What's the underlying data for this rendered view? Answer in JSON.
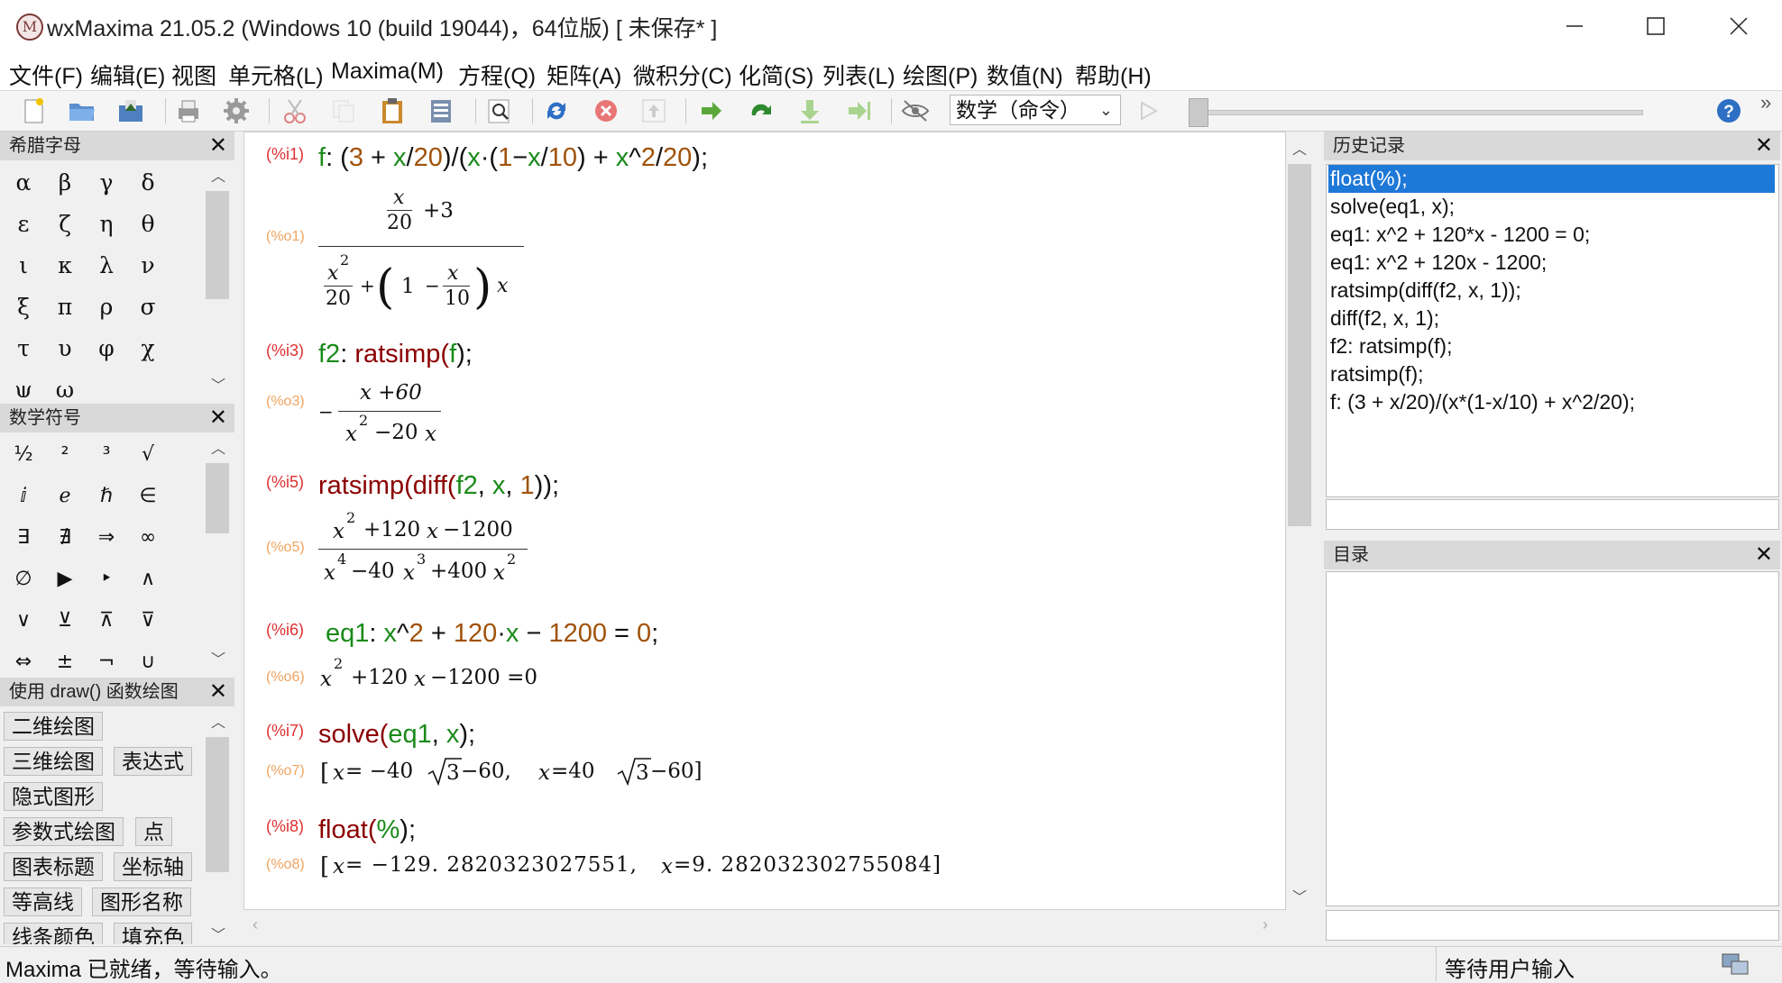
{
  "window": {
    "title": "wxMaxima 21.05.2 (Windows 10 (build 19044)，64位版) [ 未保存* ]",
    "icon": "maxima-logo-icon",
    "app_icon_glyph": "M"
  },
  "menu": [
    "文件(F)",
    "编辑(E)",
    "视图",
    "单元格(L)",
    "Maxima(M)",
    "方程(Q)",
    "矩阵(A)",
    "微积分(C)",
    "化简(S)",
    "列表(L)",
    "绘图(P)",
    "数值(N)",
    "帮助(H)"
  ],
  "toolbar": {
    "mode_select": "数学（命令）",
    "icons": [
      "new-file-icon",
      "open-folder-icon",
      "save-icon",
      "print-icon",
      "settings-icon",
      "cut-icon",
      "copy-icon",
      "paste-icon",
      "paste-special-icon",
      "find-icon",
      "refresh-icon",
      "interrupt-icon",
      "upload-icon",
      "evaluate-icon",
      "step-icon",
      "down-icon",
      "skip-icon",
      "hide-icon",
      "play-icon",
      "help-icon"
    ]
  },
  "greek_panel": {
    "title": "希腊字母",
    "letters": [
      "α",
      "β",
      "γ",
      "δ",
      "ε",
      "ζ",
      "η",
      "θ",
      "ι",
      "κ",
      "λ",
      "ν",
      "ξ",
      "π",
      "ρ",
      "σ",
      "τ",
      "υ",
      "φ",
      "χ",
      "ψ",
      "ω"
    ]
  },
  "math_panel": {
    "title": "数学符号",
    "symbols": [
      "½",
      "²",
      "³",
      "√",
      "ⅈ",
      "ℯ",
      "ℏ",
      "∈",
      "∃",
      "∄",
      "⇒",
      "∞",
      "∅",
      "▶",
      "‣",
      "∧",
      "∨",
      "⊻",
      "⊼",
      "⊽",
      "⇔",
      "±",
      "¬",
      "∪"
    ]
  },
  "draw_panel": {
    "title": "使用 draw() 函数绘图",
    "buttons": [
      [
        "二维绘图"
      ],
      [
        "三维绘图",
        "表达式"
      ],
      [
        "隐式图形"
      ],
      [
        "参数式绘图",
        "点"
      ],
      [
        "图表标题",
        "坐标轴"
      ],
      [
        "等高线",
        "图形名称"
      ],
      [
        "线条颜色",
        "填充色"
      ]
    ]
  },
  "worksheet": {
    "cells": [
      {
        "in_label": "(%i1)",
        "out_label": "(%o1)"
      },
      {
        "in_label": "(%i3)",
        "out_label": "(%o3)"
      },
      {
        "in_label": "(%i5)",
        "out_label": "(%o5)"
      },
      {
        "in_label": "(%i6)",
        "out_label": "(%o6)"
      },
      {
        "in_label": "(%i7)",
        "out_label": "(%o7)"
      },
      {
        "in_label": "(%i8)",
        "out_label": "(%o8)"
      }
    ],
    "i1": [
      "f",
      ": (",
      "3",
      " + ",
      "x",
      "/",
      "20",
      ")/(",
      "x",
      "·(",
      "1",
      "−",
      "x",
      "/",
      "10",
      ") + ",
      "x",
      "^",
      "2",
      "/",
      "20",
      ");"
    ],
    "o1": {
      "num_x": "x",
      "num_20": "20",
      "num_plus3": "+3",
      "d_x": "x",
      "d_2": "2",
      "d_20": "20",
      "d_plus": "+",
      "d_1": "1",
      "d_minus": "−",
      "d_x2": "x",
      "d_10": "10",
      "d_x3": "x"
    },
    "i3": [
      "f2",
      ": ",
      "ratsimp",
      "(",
      "f",
      ");"
    ],
    "o3": {
      "minus": "−",
      "num": "x +60",
      "den_x": "x",
      "den_2": "2",
      "den_rest": "−20 ",
      "den_x2": "x"
    },
    "i5": [
      "ratsimp",
      "(",
      "diff",
      "(",
      "f2",
      ", ",
      "x",
      ", ",
      "1",
      "));"
    ],
    "o5": {
      "n1": "x",
      "n2": "2",
      "n3": "+120 ",
      "n4": "x",
      "n5": "−1200",
      "d1": "x",
      "d2": "4",
      "d3": "−40 ",
      "d4": "x",
      "d5": "3",
      "d6": "+400 ",
      "d7": "x",
      "d8": "2"
    },
    "i6": [
      "eq1",
      ": ",
      "x",
      "^",
      "2",
      " + ",
      "120",
      "·",
      "x",
      " − ",
      "1200",
      " = ",
      "0",
      ";"
    ],
    "o6": {
      "a": "x",
      "b": "2",
      "c": "+120 ",
      "d": "x",
      "e": "−1200 =0"
    },
    "i7": [
      "solve",
      "(",
      "eq1",
      ", ",
      "x",
      ");"
    ],
    "o7": {
      "a": "[",
      "b": "x",
      "c": " = −40 ",
      "d": "3",
      "e": "−60, ",
      "f": "x",
      "g": " =40 ",
      "h": "3",
      "i": "−60]"
    },
    "i8": [
      "float",
      "(",
      "%",
      ");"
    ],
    "o8": {
      "a": "[",
      "b": "x",
      "c": " = −129. 2820323027551, ",
      "d": "x",
      "e": " =9. 282032302755084]"
    }
  },
  "history_panel": {
    "title": "历史记录",
    "items": [
      "float(%);",
      "solve(eq1, x);",
      "eq1: x^2 + 120*x - 1200 = 0;",
      "eq1: x^2 + 120x - 1200;",
      "ratsimp(diff(f2, x, 1));",
      "diff(f2, x, 1);",
      "f2: ratsimp(f);",
      "ratsimp(f);",
      "f: (3 + x/20)/(x*(1-x/10) + x^2/20);"
    ],
    "selected_index": 0
  },
  "toc_panel": {
    "title": "目录"
  },
  "status": {
    "left": "Maxima 已就绪，等待输入。",
    "right": "等待用户输入"
  },
  "colors": {
    "var_green": "#1a8a1a",
    "num_orange": "#a0520a",
    "func_darkred": "#8b0000",
    "in_label": "#e03030",
    "out_label": "#f0a35e",
    "selection": "#1e78d7"
  }
}
